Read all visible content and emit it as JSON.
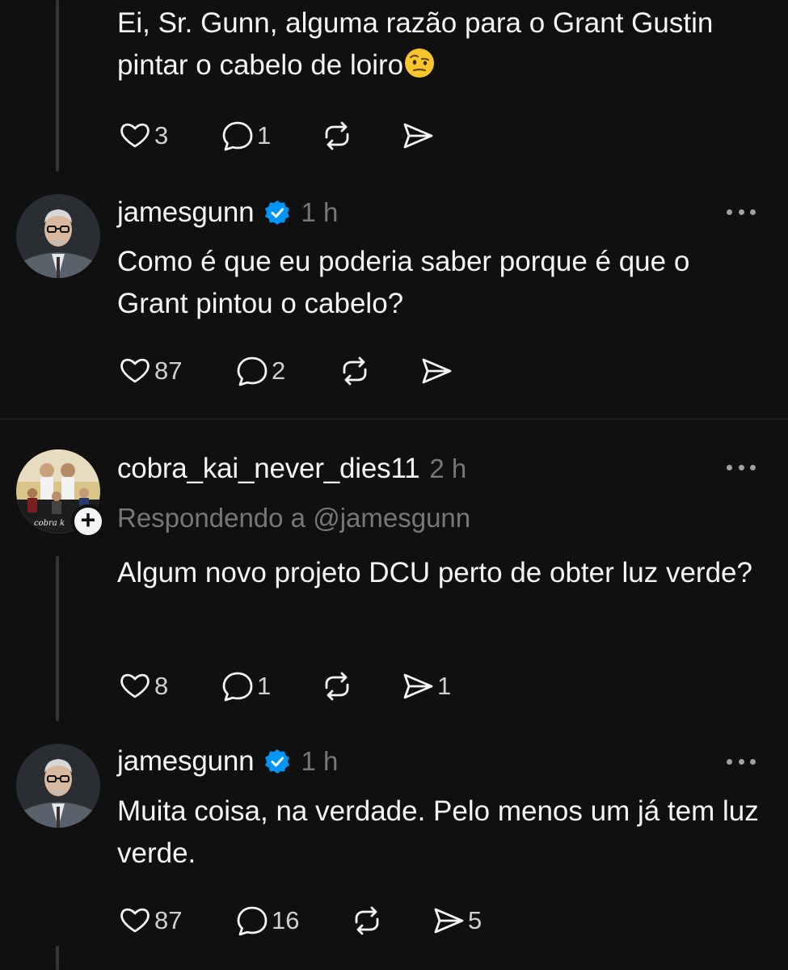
{
  "posts": [
    {
      "text": "Ei, Sr. Gunn, alguma razão para o Grant Gustin pintar o cabelo de loiro",
      "emoji": "face-with-raised-eyebrow",
      "likes": "3",
      "replies": "1",
      "reposts": "",
      "shares": ""
    },
    {
      "username": "jamesgunn",
      "verified": true,
      "time": "1 h",
      "text": "Como é que eu poderia saber porque é que o Grant pintou o cabelo?",
      "likes": "87",
      "replies": "2",
      "reposts": "",
      "shares": ""
    },
    {
      "username": "cobra_kai_never_dies11",
      "verified": false,
      "time": "2 h",
      "replying_to": "Respondendo a @jamesgunn",
      "text": "Algum novo projeto DCU perto de obter luz verde?",
      "likes": "8",
      "replies": "1",
      "reposts": "",
      "shares": "1"
    },
    {
      "username": "jamesgunn",
      "verified": true,
      "time": "1 h",
      "text": "Muita coisa, na verdade. Pelo menos um já tem luz verde.",
      "likes": "87",
      "replies": "16",
      "reposts": "",
      "shares": "5"
    }
  ],
  "icons": {
    "like": "heart-icon",
    "reply": "comment-icon",
    "repost": "repost-icon",
    "share": "send-icon",
    "more": "more-options-icon",
    "verified": "verified-badge-icon",
    "follow": "plus-icon"
  },
  "colors": {
    "background": "#101010",
    "text": "#f3f5f7",
    "secondary": "#777777",
    "verified": "#0095f6",
    "thread_line": "#333638"
  }
}
